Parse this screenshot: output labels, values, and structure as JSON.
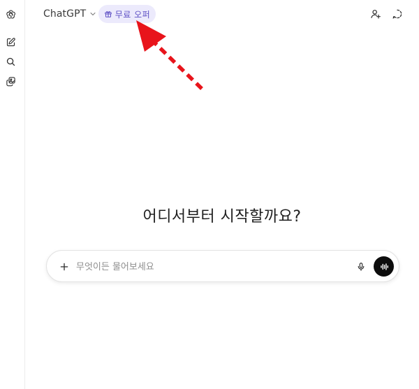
{
  "header": {
    "model_name": "ChatGPT",
    "offer_label": "무료 오퍼"
  },
  "main": {
    "heading": "어디서부터 시작할까요?"
  },
  "composer": {
    "placeholder": "무엇이든 물어보세요",
    "value": ""
  },
  "icons": {
    "rail": [
      "openai-logo-icon",
      "new-chat-icon",
      "search-icon",
      "library-icon"
    ],
    "header_right": [
      "add-person-icon",
      "temporary-chat-icon"
    ],
    "composer": [
      "plus-icon",
      "microphone-icon",
      "voice-mode-icon"
    ]
  },
  "colors": {
    "offer_pill_bg": "#eceafc",
    "offer_text": "#5d4fc4",
    "annotation_arrow": "#e8141b",
    "voice_button": "#0d0d0d"
  }
}
